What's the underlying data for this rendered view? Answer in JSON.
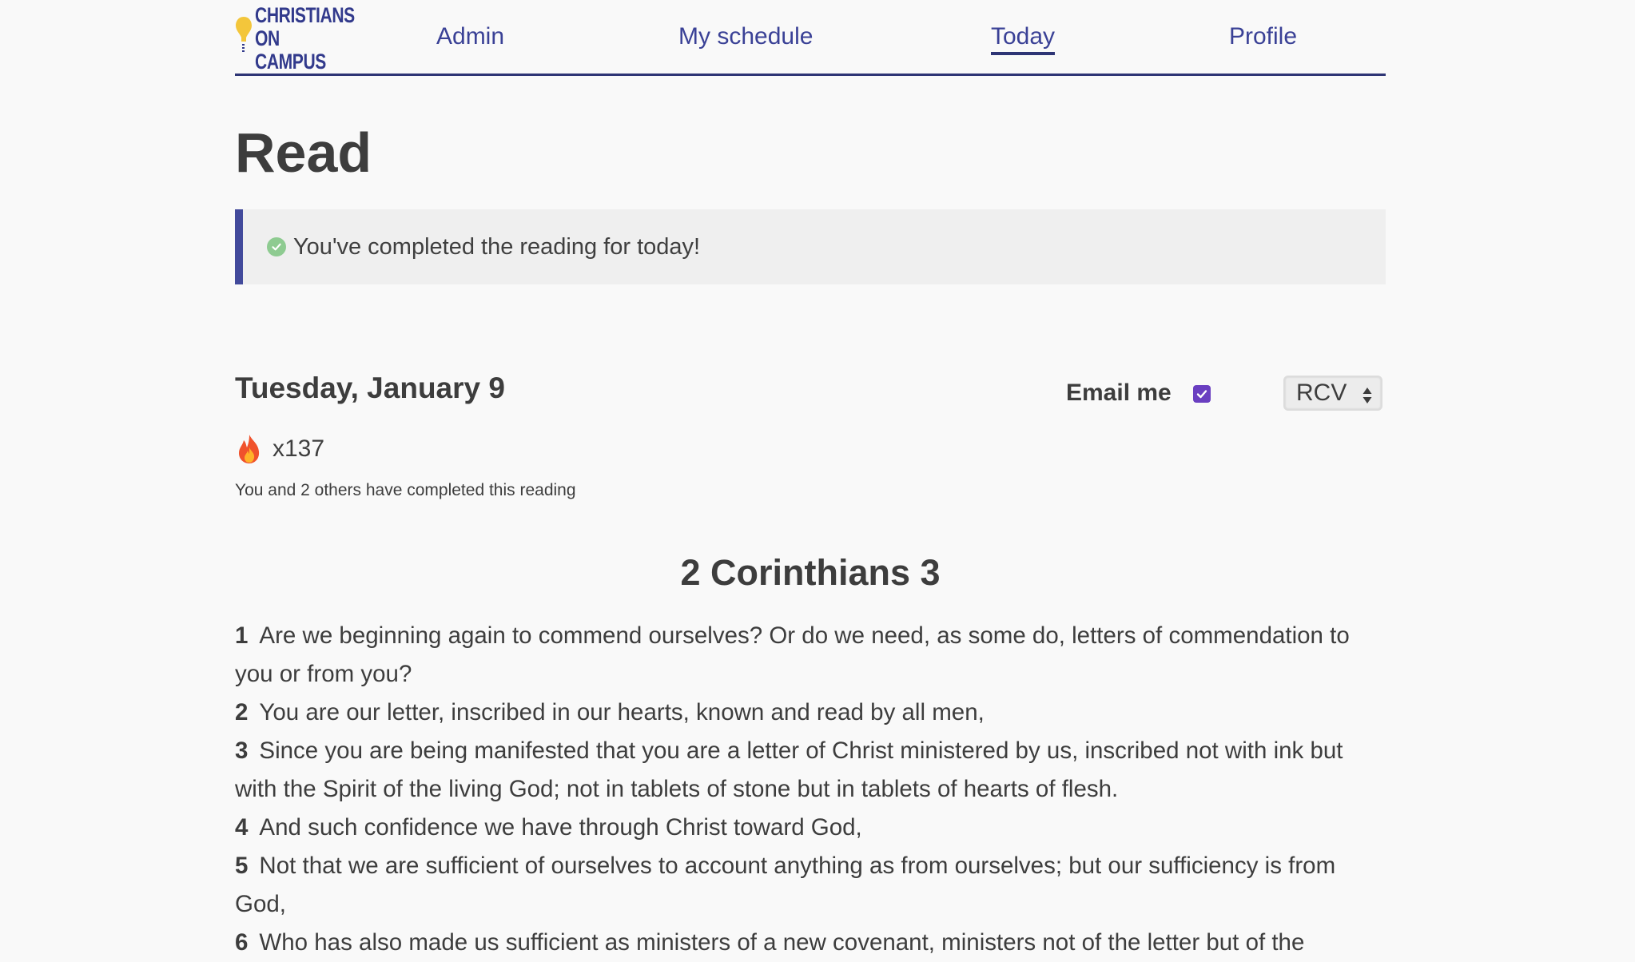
{
  "brand": {
    "line1": "CHRISTIANS",
    "line2": "ON CAMPUS",
    "accent_color": "#2e3575",
    "bulb_color": "#f3c63b"
  },
  "nav": {
    "admin": "Admin",
    "schedule": "My schedule",
    "today": "Today",
    "profile": "Profile"
  },
  "page": {
    "title": "Read"
  },
  "notice": {
    "text": "You've completed the reading for today!",
    "icon": "check-circle-icon"
  },
  "reading": {
    "date": "Tuesday, January 9",
    "email_label": "Email me",
    "email_checked": true,
    "version": "RCV",
    "streak": "x137",
    "streak_icon": "flame-icon",
    "completed_text": "You and 2 others have completed this reading",
    "chapter": "2 Corinthians 3",
    "verses": [
      {
        "num": "1",
        "text": "Are we beginning again to commend ourselves? Or do we need, as some do, letters of commendation to you or from you?"
      },
      {
        "num": "2",
        "text": "You are our letter, inscribed in our hearts, known and read by all men,"
      },
      {
        "num": "3",
        "text": "Since you are being manifested that you are a letter of Christ ministered by us, inscribed not with ink but with the Spirit of the living God; not in tablets of stone but in tablets of hearts of flesh."
      },
      {
        "num": "4",
        "text": "And such confidence we have through Christ toward God,"
      },
      {
        "num": "5",
        "text": "Not that we are sufficient of ourselves to account anything as from ourselves; but our sufficiency is from God,"
      },
      {
        "num": "6",
        "text": "Who has also made us sufficient as ministers of a new covenant, ministers not of the letter but of the"
      }
    ]
  }
}
